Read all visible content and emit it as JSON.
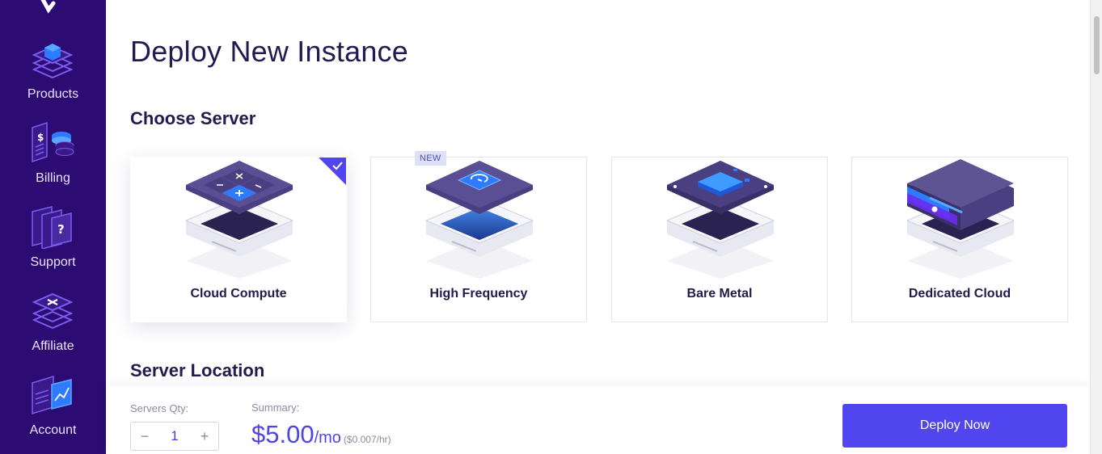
{
  "sidebar": {
    "items": [
      {
        "label": "Products",
        "icon": "products-icon"
      },
      {
        "label": "Billing",
        "icon": "billing-icon"
      },
      {
        "label": "Support",
        "icon": "support-icon"
      },
      {
        "label": "Affiliate",
        "icon": "affiliate-icon"
      },
      {
        "label": "Account",
        "icon": "account-icon"
      }
    ]
  },
  "page": {
    "title": "Deploy New Instance",
    "choose_server_title": "Choose Server",
    "server_location_title": "Server Location"
  },
  "server_types": [
    {
      "label": "Cloud Compute",
      "selected": true
    },
    {
      "label": "High Frequency",
      "badge": "NEW"
    },
    {
      "label": "Bare Metal"
    },
    {
      "label": "Dedicated Cloud"
    }
  ],
  "bottom": {
    "qty_label": "Servers Qty:",
    "qty_value": "1",
    "minus": "−",
    "plus": "+",
    "summary_label": "Summary:",
    "price": "$5.00",
    "per": "/mo",
    "hourly": "($0.007/hr)",
    "deploy_label": "Deploy Now"
  },
  "colors": {
    "sidebar_bg": "#2c0b72",
    "accent": "#5145f0",
    "price": "#4f45e4"
  }
}
